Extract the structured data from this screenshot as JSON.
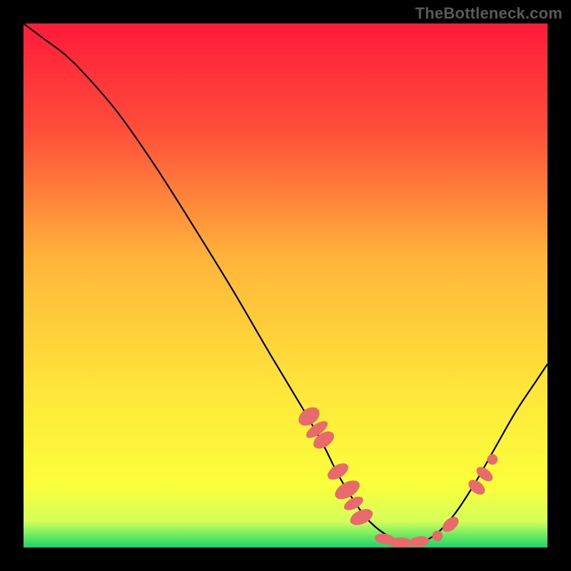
{
  "watermark": "TheBottleneck.com",
  "chart_data": {
    "type": "line",
    "title": "",
    "xlabel": "",
    "ylabel": "",
    "xlim": [
      0,
      100
    ],
    "ylim": [
      0,
      100
    ],
    "gradient_stops": [
      {
        "offset": 0,
        "color": "#ff1a3a"
      },
      {
        "offset": 20,
        "color": "#ff4d3a"
      },
      {
        "offset": 45,
        "color": "#ffb53a"
      },
      {
        "offset": 70,
        "color": "#ffe63a"
      },
      {
        "offset": 88,
        "color": "#fbff3a"
      },
      {
        "offset": 95,
        "color": "#d4ff5a"
      },
      {
        "offset": 100,
        "color": "#18d66a"
      }
    ],
    "series": [
      {
        "name": "bottleneck-curve",
        "color": "#000000",
        "x": [
          0,
          4,
          8,
          12,
          18,
          25,
          32,
          40,
          47,
          53,
          57,
          60,
          63,
          66,
          70,
          74,
          78,
          82,
          86,
          90,
          94,
          98,
          100
        ],
        "y": [
          100,
          97,
          94,
          90,
          83,
          73,
          62,
          49,
          37,
          27,
          20,
          14,
          9,
          5,
          2,
          1,
          2,
          6,
          12,
          19,
          26,
          32,
          35
        ]
      }
    ],
    "markers": {
      "color": "#e86a6a",
      "points": [
        {
          "x": 54.5,
          "y": 25.0,
          "rx": 1.5,
          "ry": 2.2,
          "rot": 55
        },
        {
          "x": 56.0,
          "y": 22.5,
          "rx": 1.0,
          "ry": 2.4,
          "rot": 55
        },
        {
          "x": 57.3,
          "y": 20.5,
          "rx": 1.3,
          "ry": 2.2,
          "rot": 56
        },
        {
          "x": 60.0,
          "y": 14.5,
          "rx": 1.2,
          "ry": 2.2,
          "rot": 58
        },
        {
          "x": 61.8,
          "y": 11.0,
          "rx": 1.4,
          "ry": 2.6,
          "rot": 60
        },
        {
          "x": 63.0,
          "y": 8.4,
          "rx": 1.0,
          "ry": 2.0,
          "rot": 62
        },
        {
          "x": 64.5,
          "y": 5.8,
          "rx": 1.3,
          "ry": 2.3,
          "rot": 65
        },
        {
          "x": 69.0,
          "y": 1.6,
          "rx": 2.0,
          "ry": 1.0,
          "rot": 10
        },
        {
          "x": 72.0,
          "y": 0.9,
          "rx": 2.2,
          "ry": 1.0,
          "rot": 0
        },
        {
          "x": 75.5,
          "y": 1.1,
          "rx": 2.0,
          "ry": 1.0,
          "rot": -8
        },
        {
          "x": 79.0,
          "y": 2.2,
          "rx": 1.0,
          "ry": 1.0,
          "rot": 0
        },
        {
          "x": 81.5,
          "y": 4.4,
          "rx": 1.8,
          "ry": 1.1,
          "rot": -40
        },
        {
          "x": 86.5,
          "y": 11.5,
          "rx": 1.1,
          "ry": 1.8,
          "rot": -52
        },
        {
          "x": 88.0,
          "y": 14.0,
          "rx": 1.0,
          "ry": 1.8,
          "rot": -52
        },
        {
          "x": 89.5,
          "y": 16.8,
          "rx": 1.0,
          "ry": 1.0,
          "rot": 0
        }
      ]
    }
  }
}
